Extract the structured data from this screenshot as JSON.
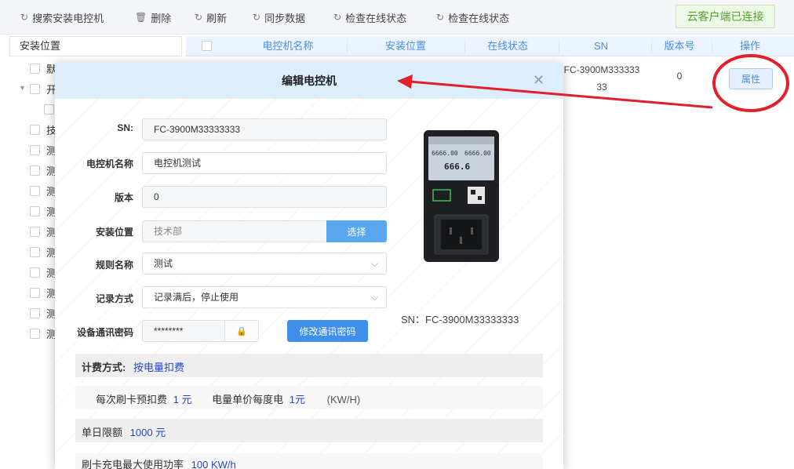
{
  "toolbar": {
    "search_label": "搜索安装电控机",
    "delete_label": "删除",
    "refresh_label": "刷新",
    "sync_label": "同步数据",
    "check_online_1": "检查在线状态",
    "check_online_2": "检查在线状态",
    "status_label": "云客户端已连接",
    "status_color": "#52a12e"
  },
  "left_panel": {
    "header": "安装位置",
    "items": [
      "默",
      "开",
      "",
      "技",
      "测",
      "测",
      "测",
      "测",
      "测",
      "测",
      "测",
      "测",
      "测",
      "测"
    ]
  },
  "table": {
    "columns": [
      "电控机名称",
      "安装位置",
      "在线状态",
      "SN",
      "版本号",
      "操作"
    ],
    "row": {
      "sn_line1": "FC-3900M333333",
      "sn_line2": "33",
      "version": "0",
      "action_label": "属性"
    }
  },
  "modal": {
    "title": "编辑电控机",
    "fields": {
      "sn_label": "SN:",
      "sn_value": "FC-3900M33333333",
      "name_label": "电控机名称",
      "name_value": "电控机测试",
      "version_label": "版本",
      "version_value": "0",
      "location_label": "安装位置",
      "location_value": "技术部",
      "location_button": "选择",
      "rule_label": "规则名称",
      "rule_value": "测试",
      "record_label": "记录方式",
      "record_value": "记录满后，停止使用",
      "password_label": "设备通讯密码",
      "password_value": "********",
      "password_button": "修改通讯密码"
    },
    "device": {
      "sn_text": "SN：FC-3900M33333333",
      "screen_top_left": "6666.00",
      "screen_top_right": "6666.00",
      "screen_main": "666.6"
    },
    "billing": {
      "mode_label": "计费方式:",
      "mode_value": "按电量扣费",
      "prepay_label": "每次刷卡预扣费",
      "prepay_value": "1 元",
      "unit_price_label": "电量单价每度电",
      "unit_price_value": "1元",
      "unit_price_unit": "(KW/H)",
      "daily_limit_label": "单日限额",
      "daily_limit_value": "1000 元",
      "max_power_label": "刷卡充电最大使用功率",
      "max_power_value": "100 KW/h"
    }
  },
  "colors": {
    "accent": "#4a90d9",
    "annotation_red": "#e0202a"
  }
}
